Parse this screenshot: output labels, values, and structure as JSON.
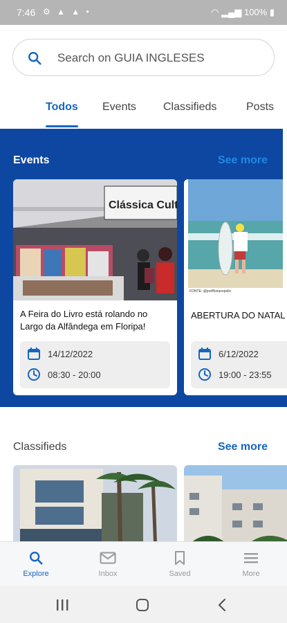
{
  "status_bar": {
    "time": "7:46",
    "battery": "100%"
  },
  "search": {
    "placeholder": "Search on GUIA INGLESES"
  },
  "tabs": [
    {
      "label": "Todos",
      "active": true
    },
    {
      "label": "Events",
      "active": false
    },
    {
      "label": "Classifieds",
      "active": false
    },
    {
      "label": "Posts",
      "active": false
    }
  ],
  "events": {
    "title": "Events",
    "see_more": "See more",
    "cards": [
      {
        "title": "A Feira do Livro está rolando no Largo da Alfândega em Floripa!",
        "image_sign": "Clássica Cultur",
        "date": "14/12/2022",
        "time": "08:30 - 20:00"
      },
      {
        "title": "ABERTURA DO NATAL",
        "image_caption": "FONTE: @prefflorianopolis",
        "date": "6/12/2022",
        "time": "19:00 - 23:55"
      }
    ]
  },
  "classifieds": {
    "title": "Classifieds",
    "see_more": "See more"
  },
  "bottom_nav": [
    {
      "label": "Explore",
      "icon": "search-icon",
      "active": true
    },
    {
      "label": "Inbox",
      "icon": "mail-icon",
      "active": false
    },
    {
      "label": "Saved",
      "icon": "bookmark-icon",
      "active": false
    },
    {
      "label": "More",
      "icon": "menu-icon",
      "active": false
    }
  ],
  "colors": {
    "primary": "#0d47a1",
    "accent": "#1565c0",
    "link": "#1e88e5"
  }
}
